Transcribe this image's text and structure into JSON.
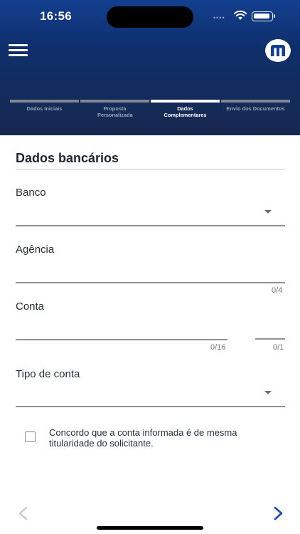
{
  "status_bar": {
    "time": "16:56",
    "signal": "••••"
  },
  "header": {
    "steps": [
      {
        "label": "Dados Iniciais",
        "active": false
      },
      {
        "label": "Proposta Personalizada",
        "active": false
      },
      {
        "label": "Dados Complementares",
        "active": true
      },
      {
        "label": "Envio dos Documentos",
        "active": false
      }
    ]
  },
  "form": {
    "section_title": "Dados bancários",
    "banco": {
      "label": "Banco",
      "value": ""
    },
    "agencia": {
      "label": "Agência",
      "value": "",
      "counter": "0/4"
    },
    "conta": {
      "label": "Conta",
      "value": "",
      "counter": "0/16",
      "digit_value": "",
      "digit_counter": "0/1"
    },
    "tipo_conta": {
      "label": "Tipo de conta",
      "value": ""
    },
    "consent": {
      "text": "Concordo que a conta informada é de mesma titularidade do solicitante.",
      "checked": false
    }
  },
  "colors": {
    "accent": "#1d4aa8",
    "header_top": "#123f8f",
    "header_bottom": "#17284e",
    "disabled": "#c5c8ce"
  },
  "icons": {
    "menu": "hamburger-icon",
    "logo": "brand-logo-icon",
    "prev": "chevron-left-icon",
    "next": "chevron-right-icon"
  }
}
